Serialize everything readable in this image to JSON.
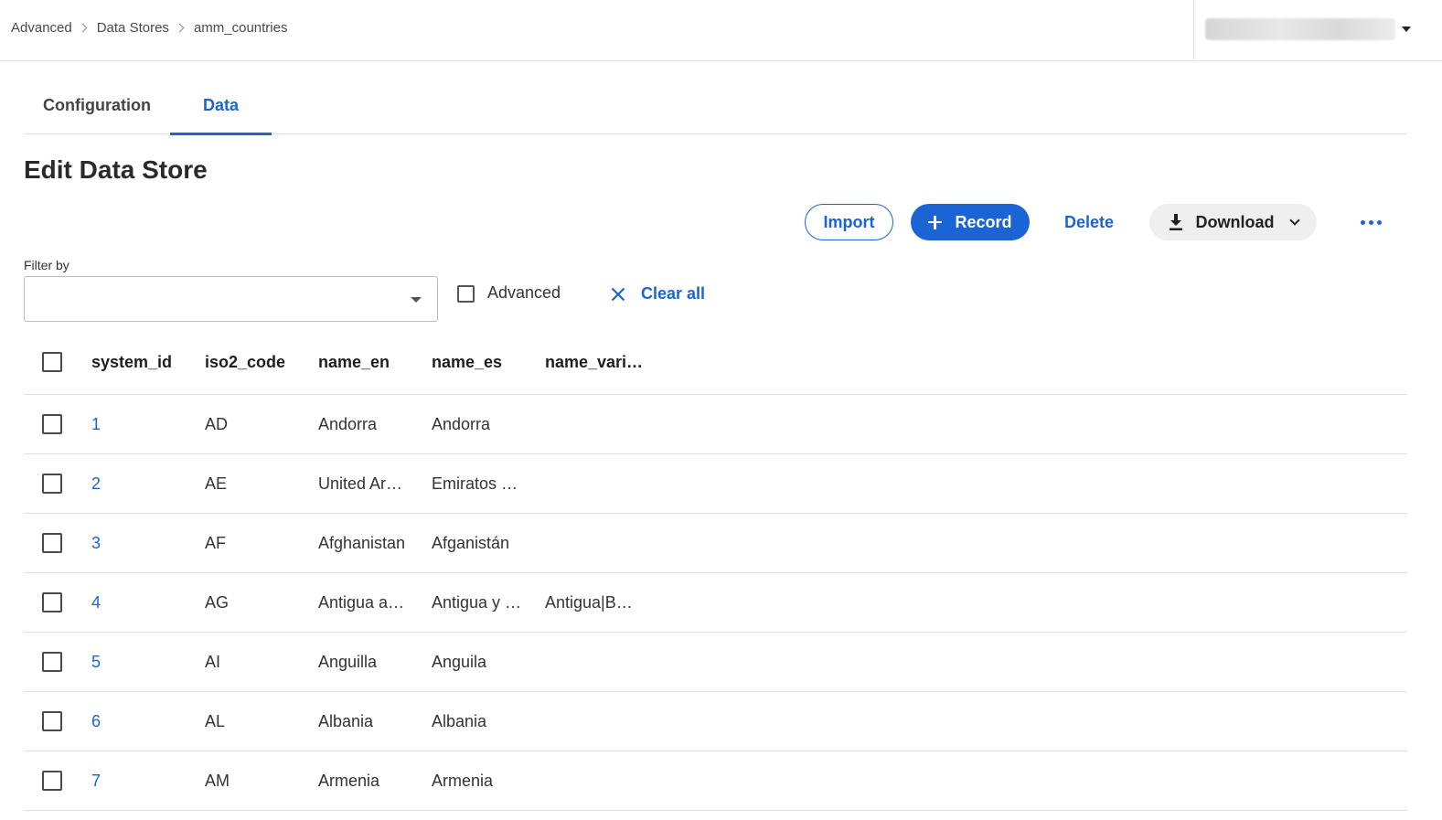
{
  "breadcrumb": [
    "Advanced",
    "Data Stores",
    "amm_countries"
  ],
  "tabs": [
    {
      "label": "Configuration",
      "active": false
    },
    {
      "label": "Data",
      "active": true
    }
  ],
  "page_title": "Edit Data Store",
  "toolbar": {
    "import_label": "Import",
    "record_label": "Record",
    "delete_label": "Delete",
    "download_label": "Download"
  },
  "filter": {
    "label": "Filter by",
    "value": "",
    "advanced_label": "Advanced",
    "advanced_checked": false,
    "clear_all_label": "Clear all"
  },
  "table": {
    "columns": [
      "system_id",
      "iso2_code",
      "name_en",
      "name_es",
      "name_vari…"
    ],
    "rows": [
      {
        "system_id": "1",
        "iso2_code": "AD",
        "name_en": "Andorra",
        "name_es": "Andorra",
        "name_variants": ""
      },
      {
        "system_id": "2",
        "iso2_code": "AE",
        "name_en": "United Ar…",
        "name_es": "Emiratos …",
        "name_variants": ""
      },
      {
        "system_id": "3",
        "iso2_code": "AF",
        "name_en": "Afghanistan",
        "name_es": "Afganistán",
        "name_variants": ""
      },
      {
        "system_id": "4",
        "iso2_code": "AG",
        "name_en": "Antigua a…",
        "name_es": "Antigua y …",
        "name_variants": "Antigua|B…"
      },
      {
        "system_id": "5",
        "iso2_code": "AI",
        "name_en": "Anguilla",
        "name_es": "Anguila",
        "name_variants": ""
      },
      {
        "system_id": "6",
        "iso2_code": "AL",
        "name_en": "Albania",
        "name_es": "Albania",
        "name_variants": ""
      },
      {
        "system_id": "7",
        "iso2_code": "AM",
        "name_en": "Armenia",
        "name_es": "Armenia",
        "name_variants": ""
      }
    ]
  },
  "colors": {
    "accent": "#1a64d6",
    "border": "#e0e0e0",
    "download_bg": "#efefef"
  },
  "icons": [
    "chevron-right-icon",
    "caret-down-icon",
    "plus-icon",
    "download-icon",
    "chevron-down-icon",
    "more-icon",
    "close-icon",
    "checkbox-icon"
  ]
}
